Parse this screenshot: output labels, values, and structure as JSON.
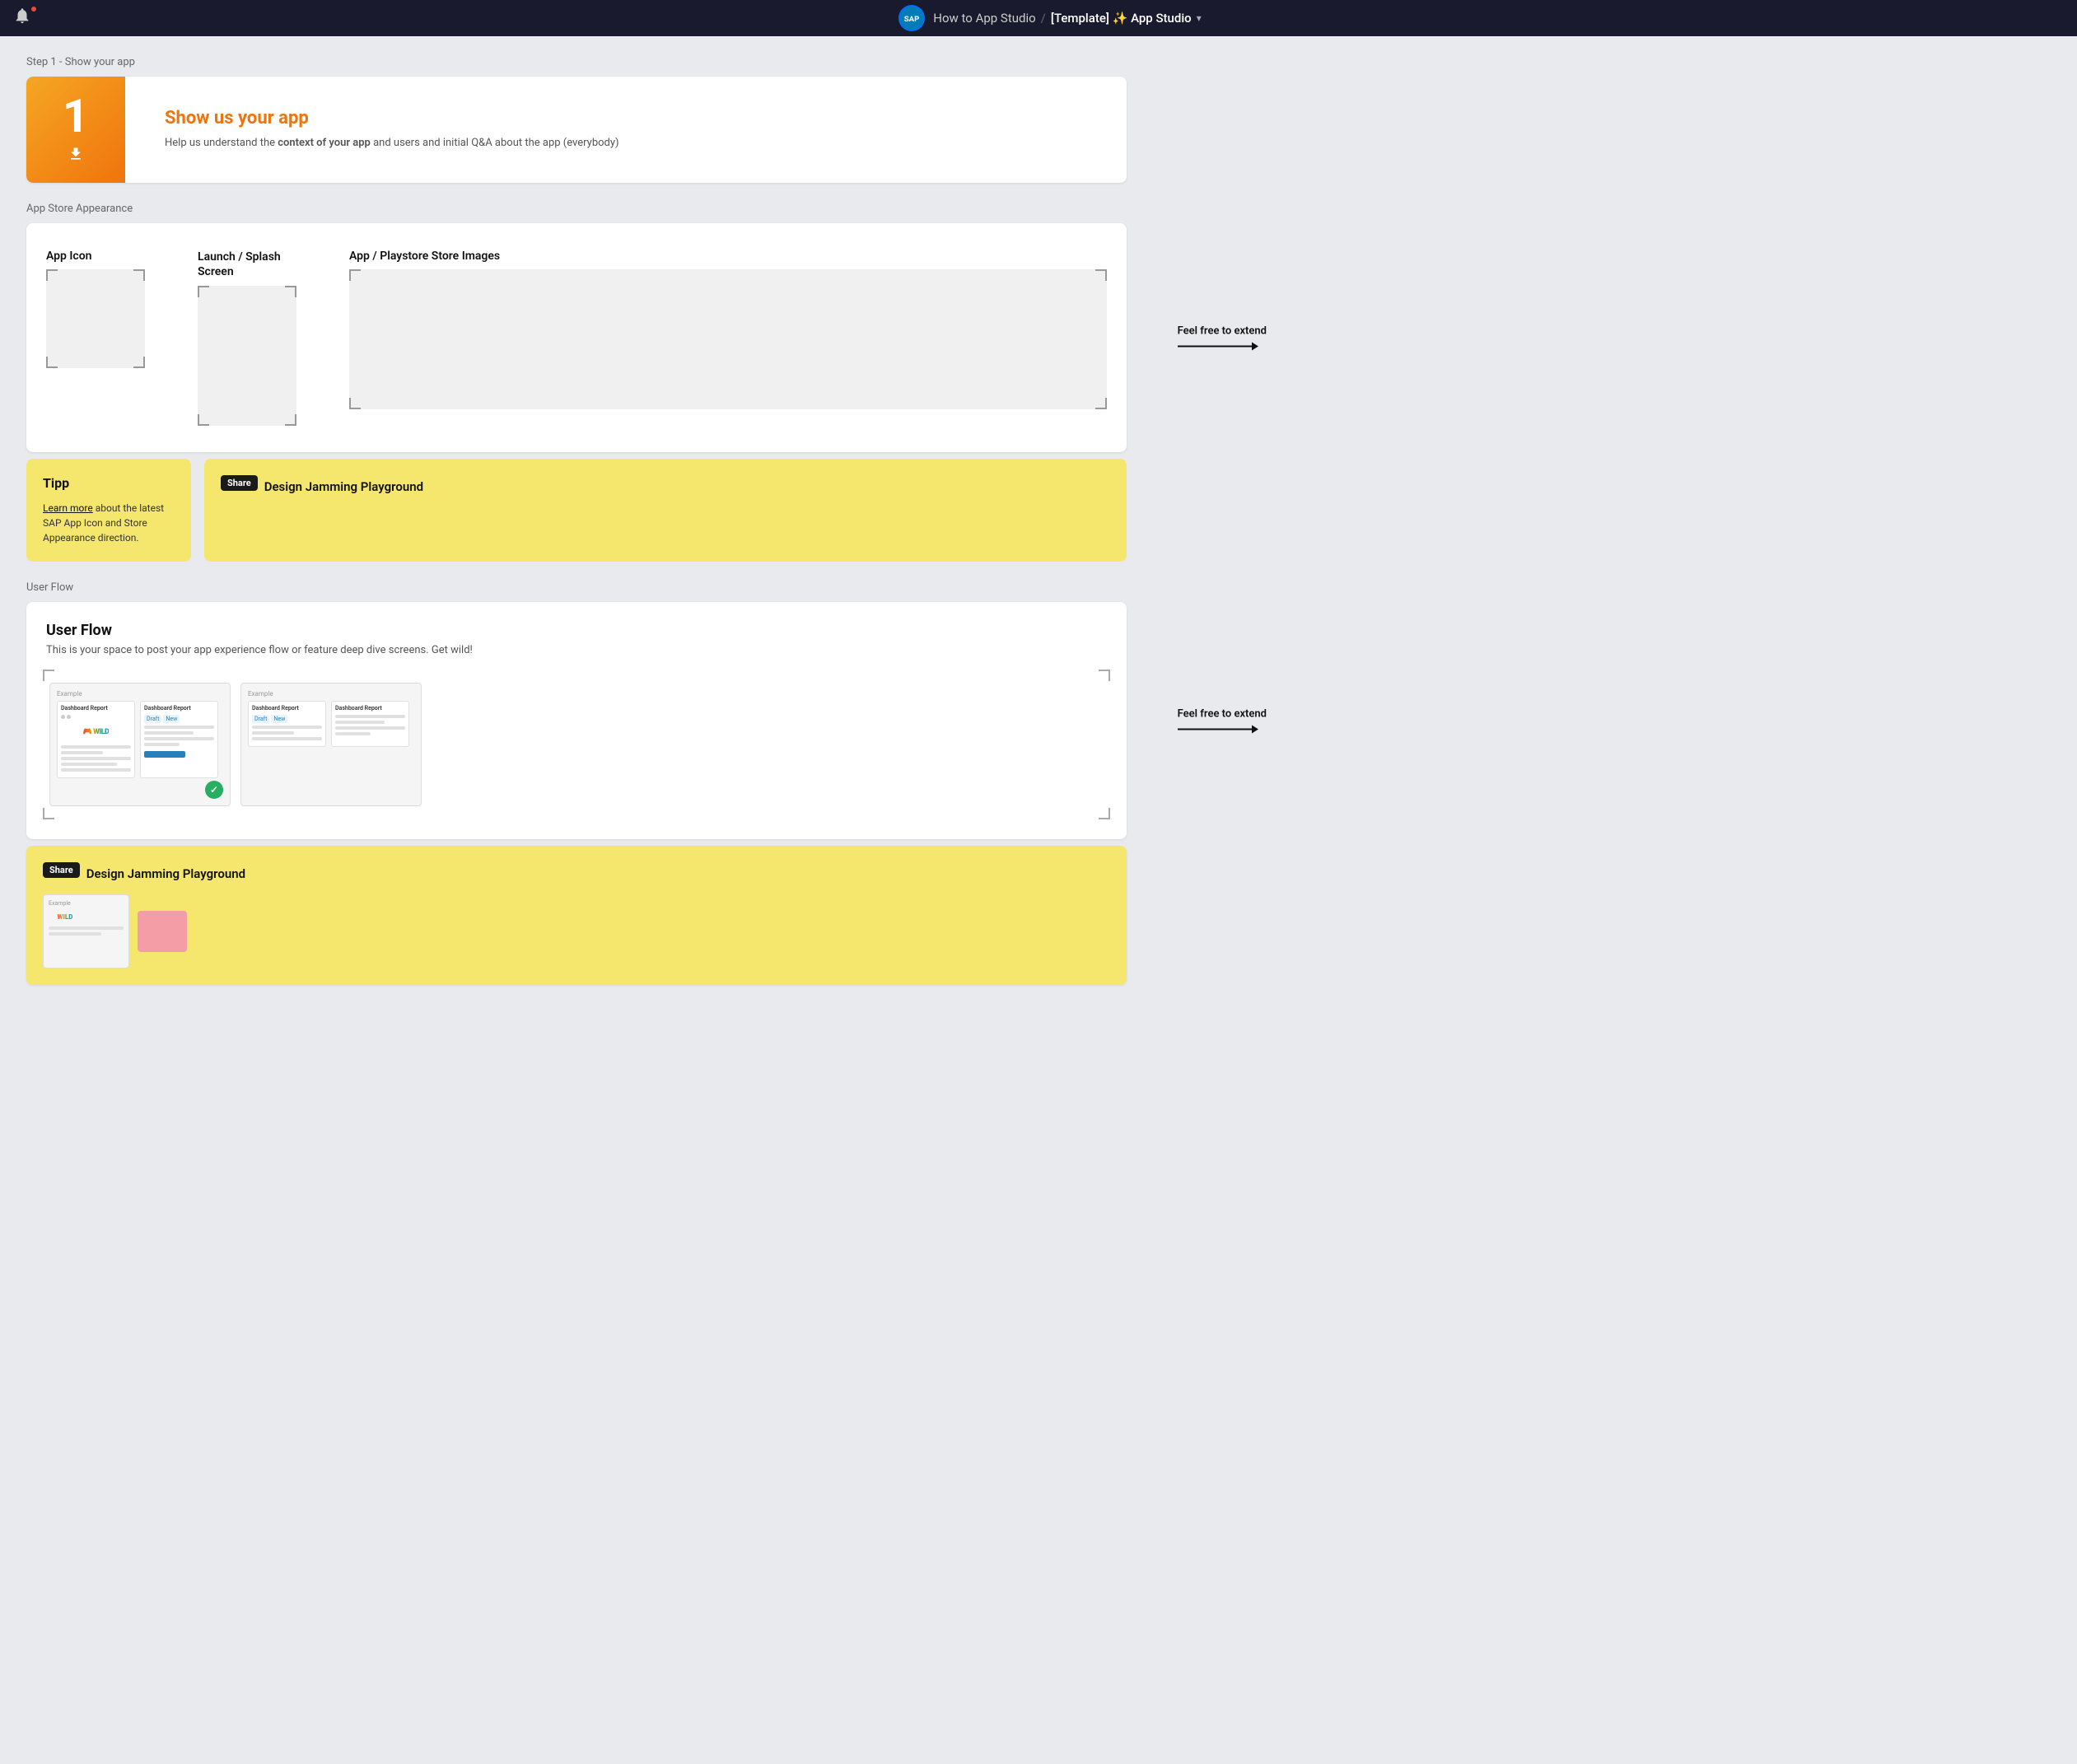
{
  "topnav": {
    "breadcrumb_parent": "How to App Studio",
    "separator": "/",
    "current": "[Template] ✨ App Studio",
    "sap_logo_text": "SAp"
  },
  "step1": {
    "label": "Step 1 - Show your app",
    "number": "1",
    "title": "Show us your app",
    "description_plain": "Help us understand the ",
    "description_bold": "context of your app",
    "description_rest": " and users and initial Q&A about the app (everybody)"
  },
  "app_store_appearance": {
    "label": "App Store Appearance",
    "col1_header": "App Icon",
    "col2_header_line1": "Launch / Splash",
    "col2_header_line2": "Screen",
    "col3_header": "App / Playstore Store Images",
    "feel_free_label": "Feel free to extend",
    "tipp_title": "Tipp",
    "tipp_link": "Learn more",
    "tipp_body": " about the latest SAP App Icon and Store Appearance direction.",
    "share_badge": "Share",
    "share_title": "Design Jamming Playground"
  },
  "user_flow": {
    "label": "User Flow",
    "title": "User Flow",
    "description": "This is your space to post your app experience flow or feature deep dive screens. Get wild!",
    "feel_free_label": "Feel free to extend",
    "share_badge": "Share",
    "share_title": "Design Jamming Playground",
    "example_label": "Example",
    "example_label2": "Example"
  }
}
